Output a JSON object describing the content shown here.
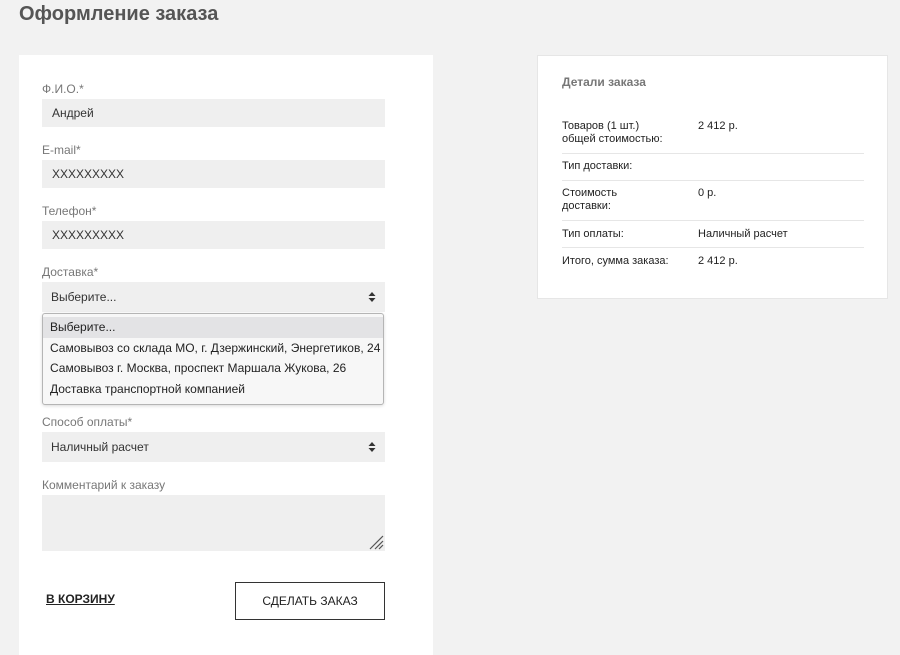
{
  "page": {
    "title": "Оформление заказа"
  },
  "form": {
    "name": {
      "label": "Ф.И.О.*",
      "value": "Андрей"
    },
    "email": {
      "label": "E-mail*",
      "value": "XXXXXXXXX"
    },
    "phone": {
      "label": "Телефон*",
      "value": "XXXXXXXXX"
    },
    "delivery": {
      "label": "Доставка*",
      "selected": "Выберите...",
      "options": [
        "Выберите...",
        "Самовывоз со склада МО, г. Дзержинский, Энергетиков, 24",
        "Самовывоз г. Москва, проспект Маршала Жукова, 26",
        "Доставка транспортной компанией"
      ]
    },
    "payment": {
      "label": "Способ оплаты*",
      "selected": "Наличный расчет"
    },
    "comment": {
      "label": "Комментарий к заказу",
      "value": ""
    },
    "back_link": "В КОРЗИНУ",
    "submit_label": "СДЕЛАТЬ ЗАКАЗ"
  },
  "details": {
    "title": "Детали заказа",
    "rows": [
      {
        "key": "Товаров (1 шт.)\nобщей стоимостью:",
        "value": "2 412 р."
      },
      {
        "key": "Тип доставки:",
        "value": ""
      },
      {
        "key": "Стоимость\nдоставки:",
        "value": "0 р."
      },
      {
        "key": "Тип оплаты:",
        "value": "Наличный расчет"
      },
      {
        "key": "Итого, сумма заказа:",
        "value": "2 412 р."
      }
    ]
  },
  "icons": {
    "select_arrows": "up-down-arrows-icon",
    "resize_grip": "resize-grip-icon"
  }
}
